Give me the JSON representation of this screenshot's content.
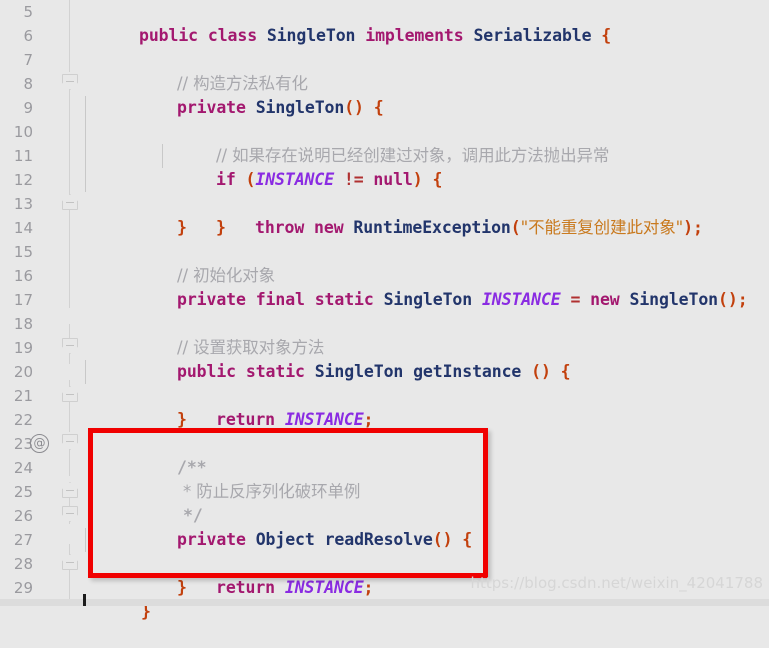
{
  "editor": {
    "background_color": "#e8e8e8",
    "first_line_number": 5,
    "line_height_px": 24,
    "language": "java"
  },
  "gutter": {
    "line_numbers": [
      "5",
      "6",
      "7",
      "8",
      "9",
      "10",
      "11",
      "12",
      "13",
      "14",
      "15",
      "16",
      "17",
      "18",
      "19",
      "20",
      "21",
      "22",
      "23",
      "24",
      "25",
      "26",
      "27",
      "28",
      "29"
    ],
    "annotation_markers": [
      {
        "line": "19",
        "glyph": "@"
      },
      {
        "line": "26",
        "glyph": "@"
      }
    ],
    "fold_markers": [
      {
        "line": "8",
        "state": "expanded-start"
      },
      {
        "line": "13",
        "state": "expanded-end"
      },
      {
        "line": "19",
        "state": "expanded-start"
      },
      {
        "line": "21",
        "state": "expanded-end"
      },
      {
        "line": "23",
        "state": "expanded-start"
      },
      {
        "line": "25",
        "state": "expanded-end"
      },
      {
        "line": "26",
        "state": "expanded-start"
      },
      {
        "line": "28",
        "state": "expanded-end"
      }
    ]
  },
  "code": {
    "lines": [
      {
        "n": "5",
        "text": "public class SingleTon implements Serializable {"
      },
      {
        "n": "6",
        "text": ""
      },
      {
        "n": "7",
        "text": "    // 构造方法私有化"
      },
      {
        "n": "8",
        "text": "    private SingleTon() {"
      },
      {
        "n": "9",
        "text": "        // 如果存在说明已经创建过对象，调用此方法抛出异常"
      },
      {
        "n": "10",
        "text": "        if (INSTANCE != null) {"
      },
      {
        "n": "11",
        "text": "            throw new RuntimeException(\"不能重复创建此对象\");"
      },
      {
        "n": "12",
        "text": "        }"
      },
      {
        "n": "13",
        "text": "    }"
      },
      {
        "n": "14",
        "text": ""
      },
      {
        "n": "15",
        "text": "    // 初始化对象"
      },
      {
        "n": "16",
        "text": "    private final static SingleTon INSTANCE = new SingleTon();"
      },
      {
        "n": "17",
        "text": ""
      },
      {
        "n": "18",
        "text": "    // 设置获取对象方法"
      },
      {
        "n": "19",
        "text": "    public static SingleTon getInstance () {"
      },
      {
        "n": "20",
        "text": "        return INSTANCE;"
      },
      {
        "n": "21",
        "text": "    }"
      },
      {
        "n": "22",
        "text": ""
      },
      {
        "n": "23",
        "text": "    /**"
      },
      {
        "n": "24",
        "text": "     * 防止反序列化破环单例"
      },
      {
        "n": "25",
        "text": "     */"
      },
      {
        "n": "26",
        "text": "    private Object readResolve() {"
      },
      {
        "n": "27",
        "text": "        return INSTANCE;"
      },
      {
        "n": "28",
        "text": "    }"
      },
      {
        "n": "29",
        "text": "}"
      }
    ],
    "tokens": {
      "line5": {
        "kw1": "public",
        "kw2": "class",
        "type1": "SingleTon",
        "kw3": "implements",
        "type2": "Serializable",
        "brace": "{"
      },
      "line7": {
        "comment": "// 构造方法私有化"
      },
      "line8": {
        "kw": "private",
        "type": "SingleTon",
        "parens": "()",
        "brace": "{"
      },
      "line9": {
        "comment": "// 如果存在说明已经创建过对象，调用此方法抛出异常"
      },
      "line10": {
        "kw": "if",
        "field": "INSTANCE",
        "operator": "!=",
        "nullkw": "null",
        "brace": "{"
      },
      "line11": {
        "kw1": "throw",
        "kw2": "new",
        "type": "RuntimeException",
        "string": "\"不能重复创建此对象\"",
        "semi": ";"
      },
      "line15": {
        "comment": "// 初始化对象"
      },
      "line16": {
        "kw1": "private",
        "kw2": "final",
        "kw3": "static",
        "type": "SingleTon",
        "field": "INSTANCE",
        "eq": "=",
        "kw4": "new",
        "type2": "SingleTon",
        "parens": "()",
        "semi": ";"
      },
      "line18": {
        "comment": "// 设置获取对象方法"
      },
      "line19": {
        "kw1": "public",
        "kw2": "static",
        "type": "SingleTon",
        "method": "getInstance",
        "parens": "()",
        "brace": "{"
      },
      "line20": {
        "kw": "return",
        "field": "INSTANCE",
        "semi": ";"
      },
      "line23": {
        "comment": "/**"
      },
      "line24": {
        "comment": "* 防止反序列化破环单例"
      },
      "line25": {
        "comment": "*/"
      },
      "line26": {
        "kw": "private",
        "type": "Object",
        "method": "readResolve",
        "parens": "()",
        "brace": "{"
      },
      "line27": {
        "kw": "return",
        "field": "INSTANCE",
        "semi": ";"
      }
    },
    "colors": {
      "keyword": "#a3186f",
      "type": "#22356b",
      "comment": "#a8a8ad",
      "string": "#c97a1f",
      "field_static": "#8a2be2",
      "brace": "#c2400d",
      "line_number": "#9a9a9f"
    }
  },
  "annotations": {
    "highlight_box": {
      "color": "#f00000",
      "covers_lines": "23-28",
      "label": "readResolve-highlight"
    }
  },
  "watermark": {
    "text": "https://blog.csdn.net/weixin_42041788"
  }
}
